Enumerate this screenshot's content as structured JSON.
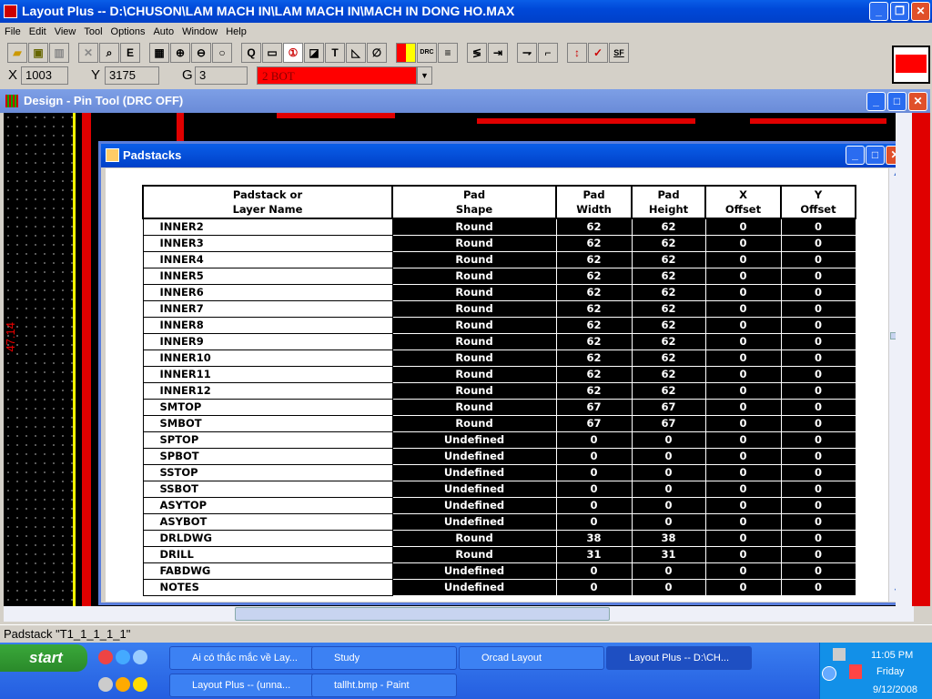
{
  "app": {
    "title": "Layout Plus -- D:\\CHUSON\\LAM MACH IN\\LAM MACH IN\\MACH IN DONG HO.MAX"
  },
  "menu": [
    "File",
    "Edit",
    "View",
    "Tool",
    "Options",
    "Auto",
    "Window",
    "Help"
  ],
  "toolbar": {
    "icons": [
      "open",
      "save",
      "library",
      "delete",
      "find",
      "E",
      "grid",
      "zoom-in",
      "zoom-out",
      "zoom-all",
      "Q",
      "component",
      "pin",
      "obstacle",
      "T",
      "connection",
      "erase",
      "color",
      "DRC",
      "error",
      "reconnect",
      "autoroute",
      "shove",
      "edit-segment",
      "add-via",
      "online-DRC",
      "SF"
    ],
    "text": {
      "e": "E",
      "q": "Q",
      "t": "T",
      "drc": "DRC",
      "sf": "SF"
    }
  },
  "coords": {
    "x_label": "X",
    "x": "1003",
    "y_label": "Y",
    "y": "3175",
    "g_label": "G",
    "g": "3",
    "layer": "2  BOT",
    "layer_color": "#ff0000"
  },
  "design_window": {
    "title": "Design - Pin Tool (DRC OFF)",
    "side_label": "47.14"
  },
  "padstacks": {
    "title": "Padstacks",
    "headers": [
      [
        "Padstack or",
        "Layer Name"
      ],
      [
        "Pad",
        "Shape"
      ],
      [
        "Pad",
        "Width"
      ],
      [
        "Pad",
        "Height"
      ],
      [
        "X",
        "Offset"
      ],
      [
        "Y",
        "Offset"
      ]
    ],
    "rows": [
      [
        "INNER2",
        "Round",
        "62",
        "62",
        "0",
        "0"
      ],
      [
        "INNER3",
        "Round",
        "62",
        "62",
        "0",
        "0"
      ],
      [
        "INNER4",
        "Round",
        "62",
        "62",
        "0",
        "0"
      ],
      [
        "INNER5",
        "Round",
        "62",
        "62",
        "0",
        "0"
      ],
      [
        "INNER6",
        "Round",
        "62",
        "62",
        "0",
        "0"
      ],
      [
        "INNER7",
        "Round",
        "62",
        "62",
        "0",
        "0"
      ],
      [
        "INNER8",
        "Round",
        "62",
        "62",
        "0",
        "0"
      ],
      [
        "INNER9",
        "Round",
        "62",
        "62",
        "0",
        "0"
      ],
      [
        "INNER10",
        "Round",
        "62",
        "62",
        "0",
        "0"
      ],
      [
        "INNER11",
        "Round",
        "62",
        "62",
        "0",
        "0"
      ],
      [
        "INNER12",
        "Round",
        "62",
        "62",
        "0",
        "0"
      ],
      [
        "SMTOP",
        "Round",
        "67",
        "67",
        "0",
        "0"
      ],
      [
        "SMBOT",
        "Round",
        "67",
        "67",
        "0",
        "0"
      ],
      [
        "SPTOP",
        "Undefined",
        "0",
        "0",
        "0",
        "0"
      ],
      [
        "SPBOT",
        "Undefined",
        "0",
        "0",
        "0",
        "0"
      ],
      [
        "SSTOP",
        "Undefined",
        "0",
        "0",
        "0",
        "0"
      ],
      [
        "SSBOT",
        "Undefined",
        "0",
        "0",
        "0",
        "0"
      ],
      [
        "ASYTOP",
        "Undefined",
        "0",
        "0",
        "0",
        "0"
      ],
      [
        "ASYBOT",
        "Undefined",
        "0",
        "0",
        "0",
        "0"
      ],
      [
        "DRLDWG",
        "Round",
        "38",
        "38",
        "0",
        "0"
      ],
      [
        "DRILL",
        "Round",
        "31",
        "31",
        "0",
        "0"
      ],
      [
        "FABDWG",
        "Undefined",
        "0",
        "0",
        "0",
        "0"
      ],
      [
        "NOTES",
        "Undefined",
        "0",
        "0",
        "0",
        "0"
      ]
    ]
  },
  "status": "Padstack \"T1_1_1_1_1\"",
  "taskbar": {
    "start": "start",
    "row1": [
      "Ai có thắc mắc về Lay...",
      "Study",
      "Orcad Layout",
      "Layout Plus -- D:\\CH..."
    ],
    "row2": [
      "Layout Plus -- (unna...",
      "tallht.bmp - Paint"
    ],
    "time": "11:05 PM",
    "day": "Friday",
    "date": "9/12/2008"
  }
}
